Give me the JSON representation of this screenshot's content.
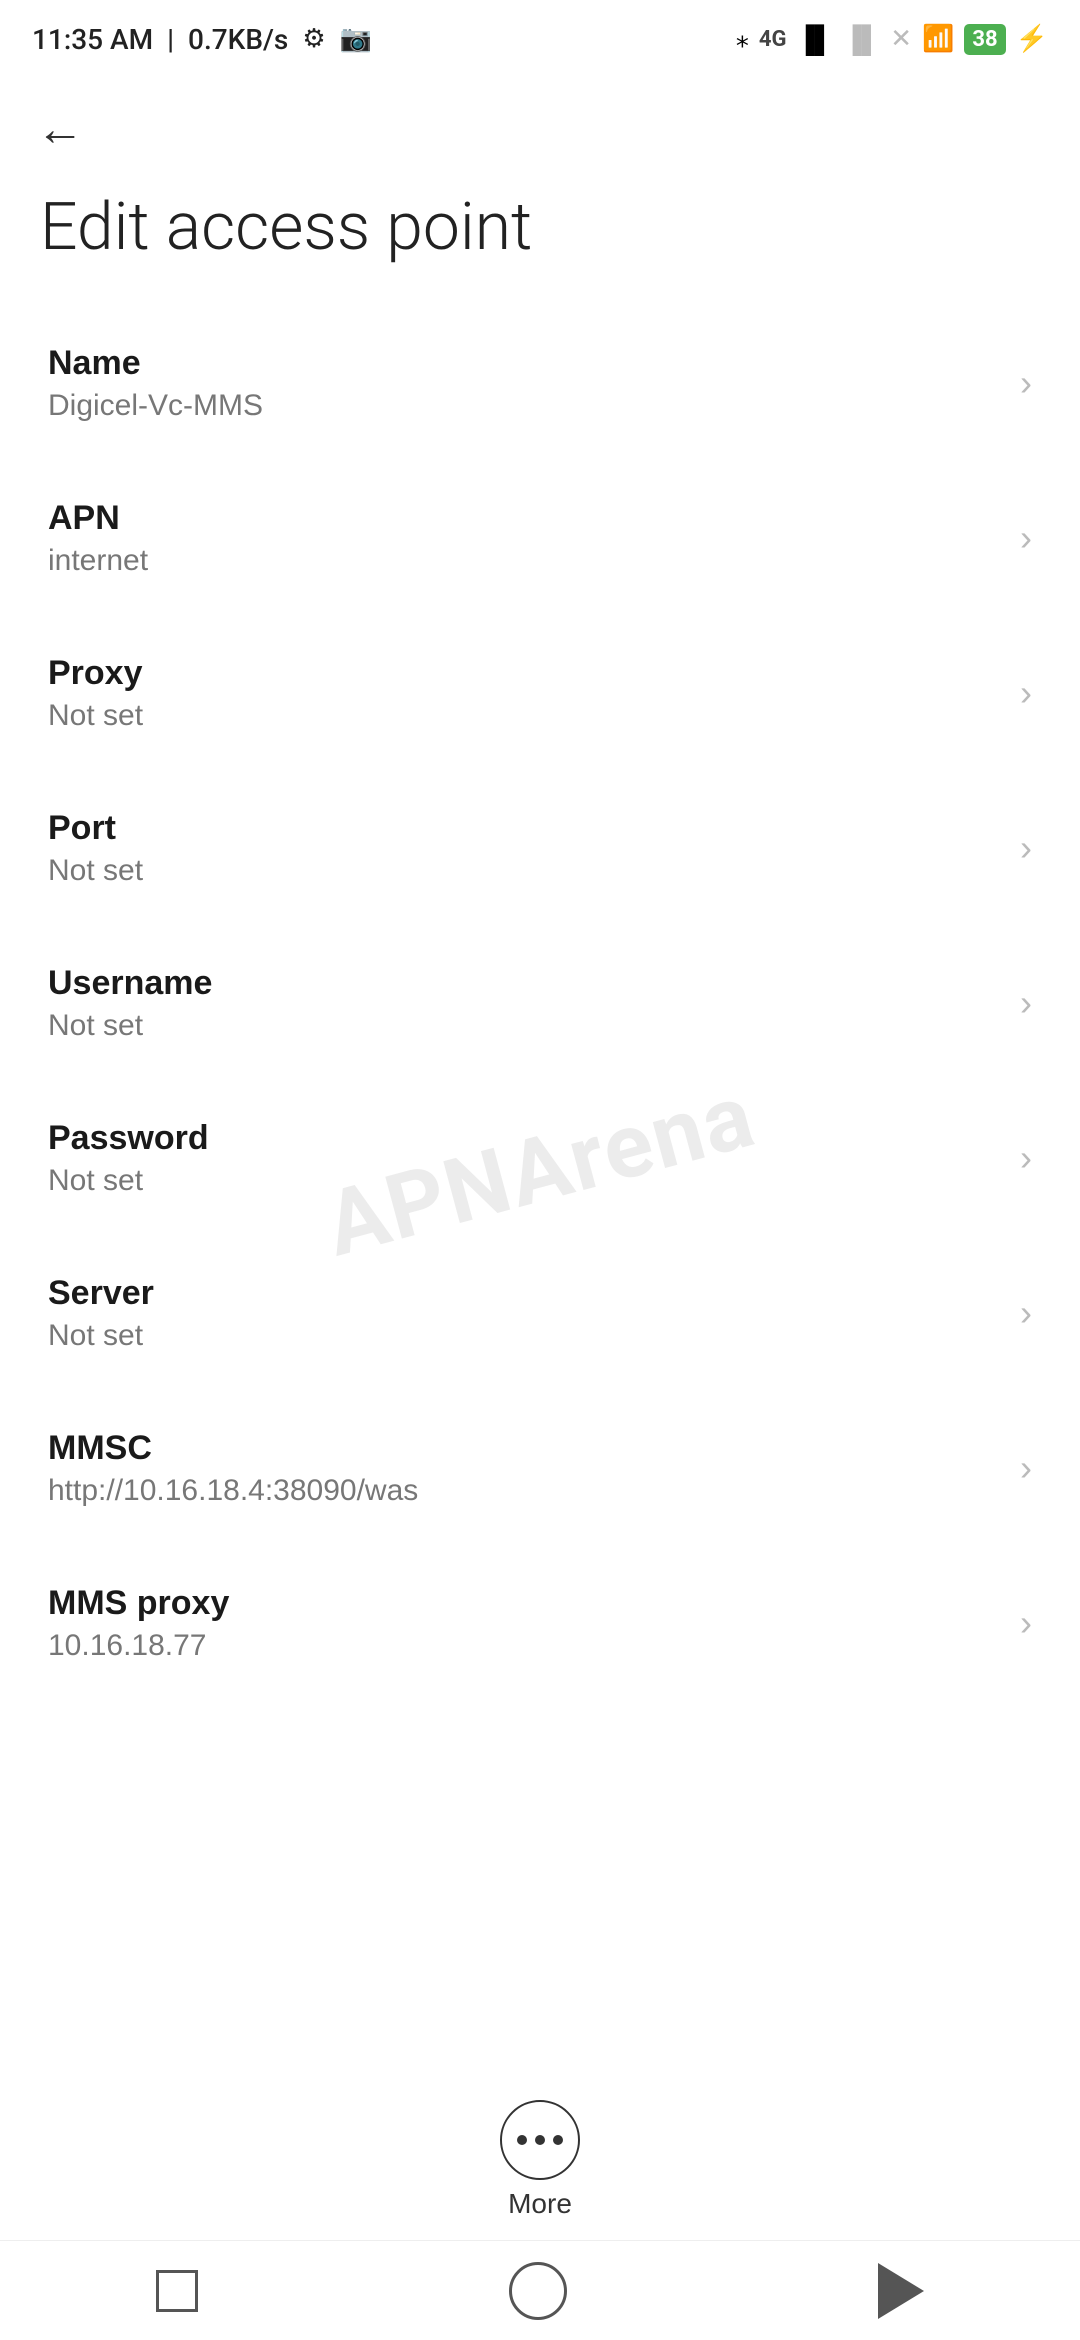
{
  "statusBar": {
    "time": "11:35 AM",
    "network": "0.7KB/s",
    "battery": "38"
  },
  "nav": {
    "backLabel": "←"
  },
  "page": {
    "title": "Edit access point"
  },
  "settings": [
    {
      "label": "Name",
      "value": "Digicel-Vc-MMS"
    },
    {
      "label": "APN",
      "value": "internet"
    },
    {
      "label": "Proxy",
      "value": "Not set"
    },
    {
      "label": "Port",
      "value": "Not set"
    },
    {
      "label": "Username",
      "value": "Not set"
    },
    {
      "label": "Password",
      "value": "Not set"
    },
    {
      "label": "Server",
      "value": "Not set"
    },
    {
      "label": "MMSC",
      "value": "http://10.16.18.4:38090/was"
    },
    {
      "label": "MMS proxy",
      "value": "10.16.18.77"
    }
  ],
  "more": {
    "label": "More"
  },
  "bottomNav": {
    "square": "■",
    "circle": "○",
    "back": "◀"
  }
}
